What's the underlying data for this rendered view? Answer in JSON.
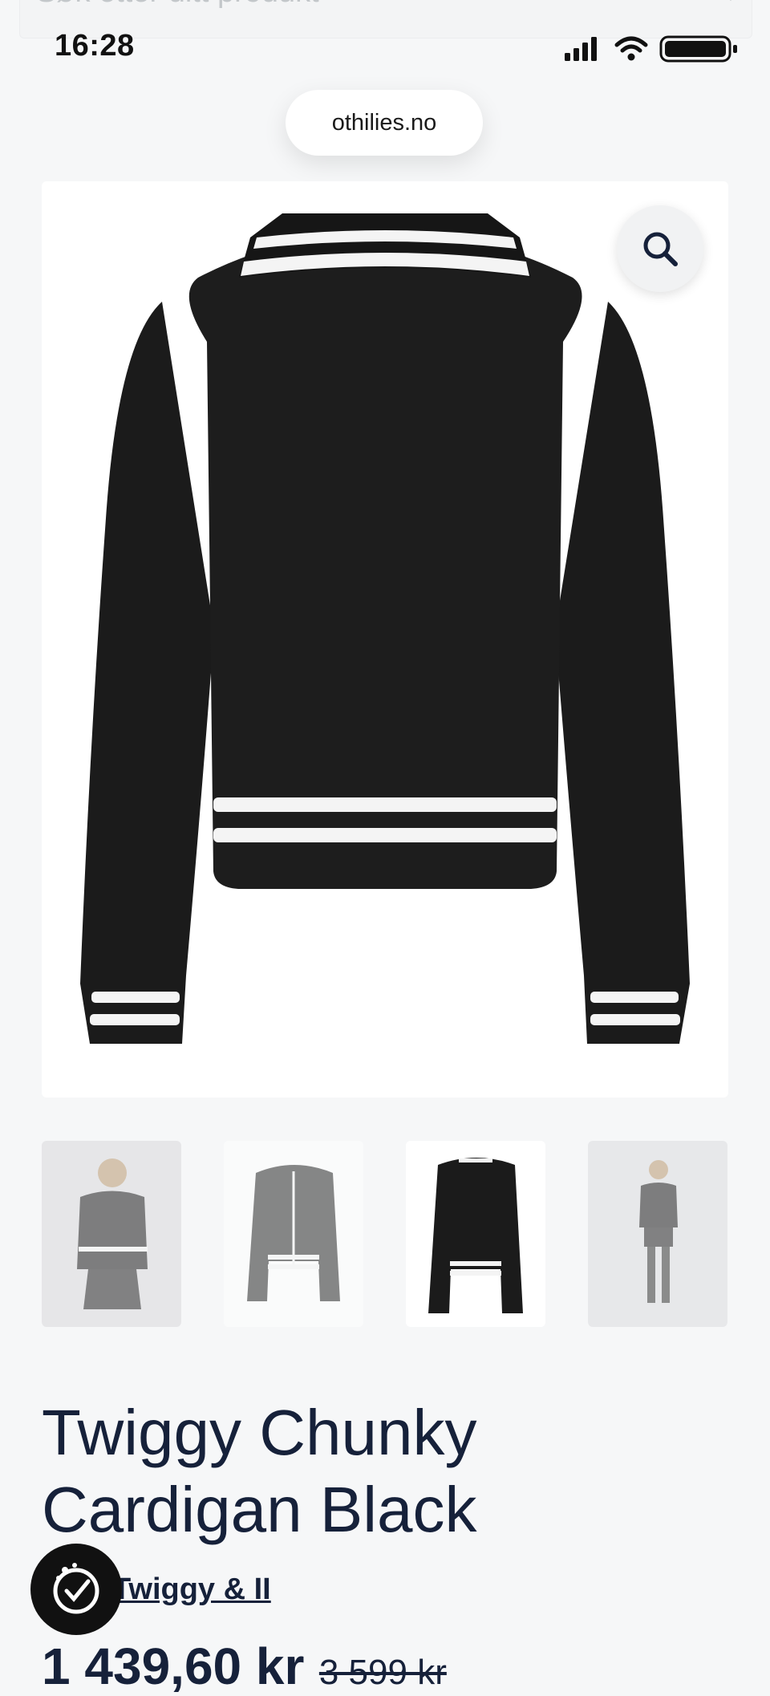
{
  "search": {
    "placeholder": "Søk etter ditt produkt"
  },
  "status_bar": {
    "time": "16:28"
  },
  "browser": {
    "url": "othilies.no"
  },
  "product": {
    "title_line1": "Twiggy Chunky",
    "title_line2": "Cardigan Black",
    "brand_link": "Twiggy & II",
    "price": "1 439,60 kr",
    "old_price": "3 599 kr"
  },
  "gallery": {
    "thumbnails": [
      {
        "label": "model-front",
        "active": false
      },
      {
        "label": "cardigan-front",
        "active": false
      },
      {
        "label": "cardigan-back",
        "active": true
      },
      {
        "label": "model-full",
        "active": false
      }
    ]
  },
  "colors": {
    "text": "#16213a",
    "background": "#f6f7f8",
    "garment": "#1b1b1b",
    "stripe": "#f4f4f4"
  },
  "icons": [
    "search-icon",
    "signal-icon",
    "wifi-icon",
    "battery-icon",
    "zoom-icon",
    "accessibility-icon"
  ]
}
